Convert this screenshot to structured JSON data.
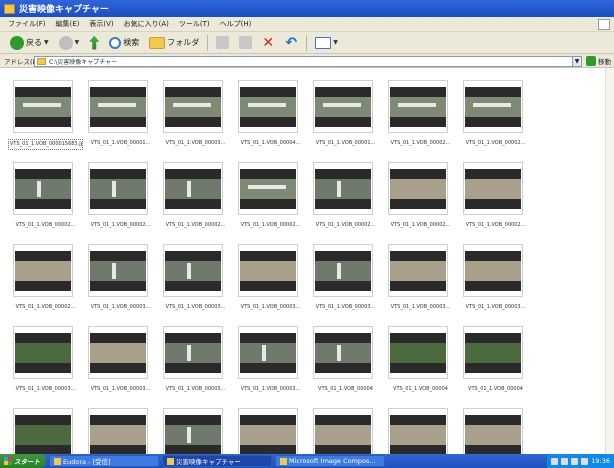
{
  "window": {
    "title": "災害映像キャプチャー",
    "menu": [
      "ファイル(F)",
      "編集(E)",
      "表示(V)",
      "お気に入り(A)",
      "ツール(T)",
      "ヘルプ(H)"
    ]
  },
  "toolbar": {
    "back_label": "戻る",
    "search_label": "検索",
    "folders_label": "フォルダ"
  },
  "address": {
    "label": "アドレス(D)",
    "path": "C:\\災害映像キャプチャー",
    "go_label": "移動"
  },
  "files": [
    {
      "name": "VTS_01_1.VOB_000015683.jpg",
      "scene": "road"
    },
    {
      "name": "VTS_01_1.VOB_00001...",
      "scene": "road"
    },
    {
      "name": "VTS_01_1.VOB_00003...",
      "scene": "road"
    },
    {
      "name": "VTS_01_1.VOB_00004...",
      "scene": "road"
    },
    {
      "name": "VTS_01_1.VOB_00001...",
      "scene": "road"
    },
    {
      "name": "VTS_01_1.VOB_00002...",
      "scene": "road"
    },
    {
      "name": "VTS_01_1.VOB_00002...",
      "scene": "road"
    },
    {
      "name": "VTS_01_1.VOB_00002...",
      "scene": "city"
    },
    {
      "name": "VTS_01_1.VOB_00002...",
      "scene": "city"
    },
    {
      "name": "VTS_01_1.VOB_00002...",
      "scene": "city"
    },
    {
      "name": "VTS_01_1.VOB_00002...",
      "scene": "road"
    },
    {
      "name": "VTS_01_1.VOB_00002...",
      "scene": "city"
    },
    {
      "name": "VTS_01_1.VOB_00002...",
      "scene": "field"
    },
    {
      "name": "VTS_01_1.VOB_00002...",
      "scene": "field"
    },
    {
      "name": "VTS_01_1.VOB_00002...",
      "scene": "field"
    },
    {
      "name": "VTS_01_1.VOB_00003...",
      "scene": "city"
    },
    {
      "name": "VTS_01_1.VOB_00003...",
      "scene": "city"
    },
    {
      "name": "VTS_01_1.VOB_00003...",
      "scene": "field"
    },
    {
      "name": "VTS_01_1.VOB_00003...",
      "scene": "city"
    },
    {
      "name": "VTS_01_1.VOB_00003...",
      "scene": "field"
    },
    {
      "name": "VTS_01_1.VOB_00003...",
      "scene": "field"
    },
    {
      "name": "VTS_01_1.VOB_00003...",
      "scene": "forest"
    },
    {
      "name": "VTS_01_1.VOB_00003...",
      "scene": "field"
    },
    {
      "name": "VTS_01_1.VOB_00003...",
      "scene": "city"
    },
    {
      "name": "VTS_01_1.VOB_00003...",
      "scene": "city"
    },
    {
      "name": "VTS_01_1.VOB_00004",
      "scene": "city"
    },
    {
      "name": "VTS_01_1.VOB_00004",
      "scene": "forest"
    },
    {
      "name": "VTS_01_1.VOB_00004",
      "scene": "forest"
    },
    {
      "name": "",
      "scene": "forest"
    },
    {
      "name": "",
      "scene": "field"
    },
    {
      "name": "",
      "scene": "city"
    },
    {
      "name": "",
      "scene": "field"
    },
    {
      "name": "",
      "scene": "field"
    },
    {
      "name": "",
      "scene": "field"
    },
    {
      "name": "",
      "scene": "field"
    }
  ],
  "taskbar": {
    "start_label": "スタート",
    "tasks": [
      {
        "label": "Eudora - [受信]",
        "active": false
      },
      {
        "label": "災害映像キャプチャー",
        "active": true
      },
      {
        "label": "Microsoft Image Compos...",
        "active": false
      }
    ],
    "clock": "19:36"
  },
  "colors": {
    "titlebar": "#2f66d8",
    "chrome": "#ece9d8",
    "taskbar": "#3168d5",
    "start": "#3c9b3c"
  }
}
